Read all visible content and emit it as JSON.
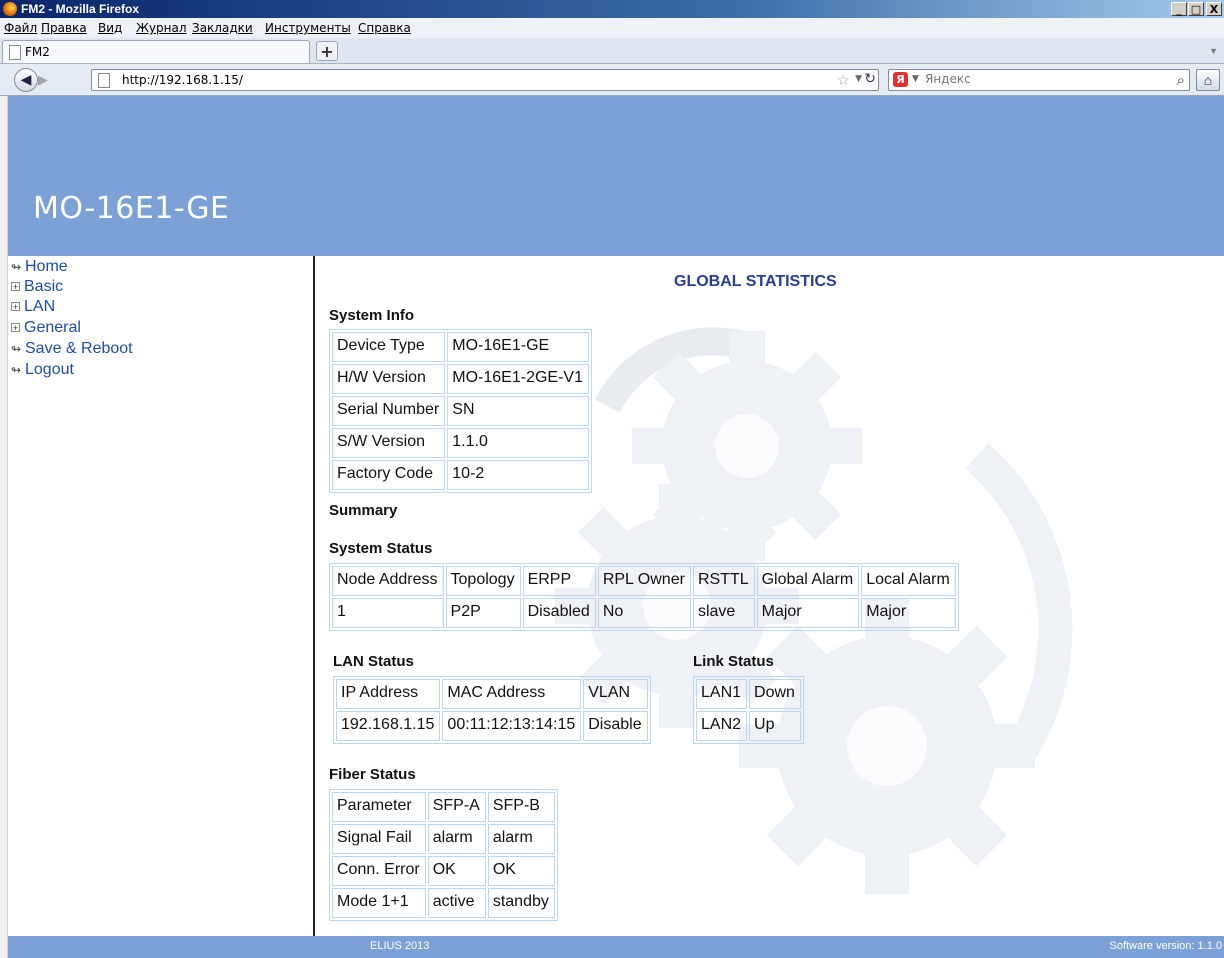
{
  "window": {
    "title": "FM2 - Mozilla Firefox",
    "minimize": "_",
    "maximize": "□",
    "close": "X"
  },
  "menu": [
    "Файл",
    "Правка",
    "Вид",
    "Журнал",
    "Закладки",
    "Инструменты",
    "Справка"
  ],
  "tab": {
    "label": "FM2",
    "new_tab": "+"
  },
  "nav": {
    "url": "http://192.168.1.15/",
    "search_placeholder": "Яндекс",
    "search_engine_badge": "Я"
  },
  "brand": "MO-16E1-GE",
  "sidebar": [
    {
      "label": "Home",
      "icon": "arrow-icon"
    },
    {
      "label": "Basic",
      "icon": "plus-box-icon"
    },
    {
      "label": "LAN",
      "icon": "plus-box-icon"
    },
    {
      "label": "General",
      "icon": "plus-box-icon"
    },
    {
      "label": "Save & Reboot",
      "icon": "arrow-icon"
    },
    {
      "label": "Logout",
      "icon": "arrow-icon"
    }
  ],
  "page_title": "GLOBAL STATISTICS",
  "system_info": {
    "heading": "System Info",
    "rows": [
      [
        "Device Type",
        "MO-16E1-GE"
      ],
      [
        "H/W Version",
        "MO-16E1-2GE-V1"
      ],
      [
        "Serial Number",
        "SN"
      ],
      [
        "S/W Version",
        "1.1.0"
      ],
      [
        "Factory Code",
        "10-2"
      ]
    ]
  },
  "summary_heading": "Summary",
  "system_status": {
    "heading": "System Status",
    "headers": [
      "Node Address",
      "Topology",
      "ERPP",
      "RPL Owner",
      "RSTTL",
      "Global Alarm",
      "Local Alarm"
    ],
    "values": [
      "1",
      "P2P",
      "Disabled",
      "No",
      "slave",
      "Major",
      "Major"
    ]
  },
  "lan_status": {
    "heading": "LAN Status",
    "headers": [
      "IP Address",
      "MAC Address",
      "VLAN"
    ],
    "values": [
      "192.168.1.15",
      "00:11:12:13:14:15",
      "Disable"
    ]
  },
  "link_status": {
    "heading": "Link Status",
    "rows": [
      [
        "LAN1",
        "Down"
      ],
      [
        "LAN2",
        "Up"
      ]
    ]
  },
  "fiber_status": {
    "heading": "Fiber Status",
    "rows": [
      [
        "Parameter",
        "SFP-A",
        "SFP-B"
      ],
      [
        "Signal Fail",
        "alarm",
        "alarm"
      ],
      [
        "Conn. Error",
        "OK",
        "OK"
      ],
      [
        "Mode 1+1",
        "active",
        "standby"
      ]
    ]
  },
  "footer": {
    "copyright": "ELIUS 2013",
    "version": "Software version: 1.1.0"
  },
  "colors": {
    "banner": "#7ba1d6",
    "title": "#2a3c9a",
    "link": "#1e4ea8",
    "table_border": "#bcd6ee"
  }
}
